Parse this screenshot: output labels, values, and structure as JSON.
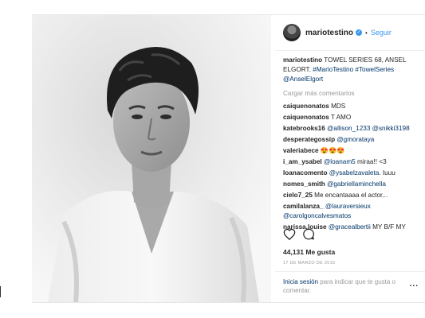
{
  "header": {
    "username": "mariotestino",
    "verified_icon": "verified-check-icon",
    "dot": "•",
    "follow_label": "Seguir"
  },
  "caption": {
    "username": "mariotestino",
    "text": "TOWEL SERIES 68, ANSEL ELGORT.",
    "tags": "#MarioTestino #TowelSeries",
    "mention": "@AnselElgort"
  },
  "load_more": "Cargar más comentarios",
  "comments": [
    {
      "user": "caiquenonatos",
      "pre": "MDS",
      "link": "",
      "post": ""
    },
    {
      "user": "caiquenonatos",
      "pre": "T AMO",
      "link": "",
      "post": ""
    },
    {
      "user": "katebrooks16",
      "pre": "",
      "link": "@allison_1233 @snikki3198",
      "post": ""
    },
    {
      "user": "desperategossip",
      "pre": "",
      "link": "@gmorataya",
      "post": ""
    },
    {
      "user": "valeriabece",
      "pre": "😍😍😍",
      "link": "",
      "post": ""
    },
    {
      "user": "i_am_ysabel",
      "pre": "",
      "link": "@loanam5",
      "post": "miraa!! <3"
    },
    {
      "user": "loanacomento",
      "pre": "",
      "link": "@ysabelzavaleta",
      "post": ". Iuuu"
    },
    {
      "user": "nomes_smith",
      "pre": "",
      "link": "@gabriellaminchella",
      "post": ""
    },
    {
      "user": "cielo7_25",
      "pre": "Me encantaaaa el actor...",
      "link": "",
      "post": ""
    },
    {
      "user": "camilalanza_",
      "pre": "",
      "link": "@lauraversieux @carolgoncalvesmatos",
      "post": ""
    },
    {
      "user": "narissa.louise",
      "pre": "",
      "link": "@gracealbertii",
      "post": "MY B/F MY"
    }
  ],
  "actions": {
    "like_icon": "heart-outline-icon",
    "comment_icon": "comment-bubble-icon"
  },
  "likes": "44,131 Me gusta",
  "date": "17 DE MARZO DE 2015",
  "login": {
    "link": "Inicia sesión",
    "text": "para indicar que te gusta o comentar."
  },
  "more_label": "..."
}
